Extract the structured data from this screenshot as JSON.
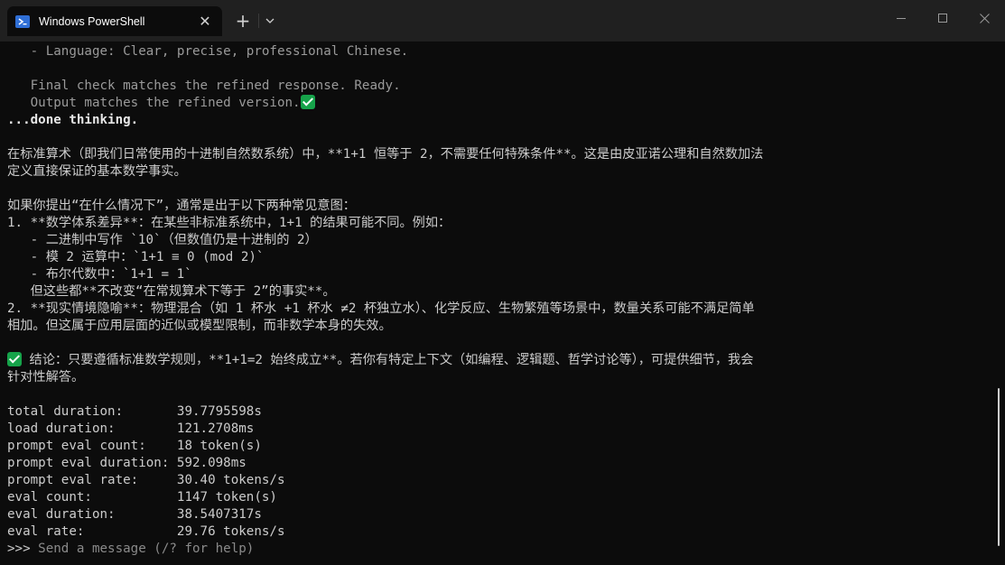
{
  "window": {
    "tab_title": "Windows PowerShell",
    "tab_close_glyph": "✕",
    "new_tab_glyph": "+",
    "dropdown_glyph": "⌄"
  },
  "terminal": {
    "lines": [
      {
        "text": "   - Language: Clear, precise, professional Chinese.",
        "style": "dim"
      },
      {
        "text": "",
        "style": ""
      },
      {
        "text": "   Final check matches the refined response. Ready.",
        "style": "dim"
      },
      {
        "text": "   Output matches the refined version.",
        "style": "dim",
        "check": true
      },
      {
        "text": "...done thinking.",
        "style": "bold"
      },
      {
        "text": "",
        "style": ""
      },
      {
        "text": "在标准算术（即我们日常使用的十进制自然数系统）中，**1+1 恒等于 2，不需要任何特殊条件**。这是由皮亚诺公理和自然数加法",
        "style": ""
      },
      {
        "text": "定义直接保证的基本数学事实。",
        "style": ""
      },
      {
        "text": "",
        "style": ""
      },
      {
        "text": "如果你提出“在什么情况下”，通常是出于以下两种常见意图：",
        "style": ""
      },
      {
        "text": "1. **数学体系差异**：在某些非标准系统中，1+1 的结果可能不同。例如：",
        "style": ""
      },
      {
        "text": "   - 二进制中写作 `10`（但数值仍是十进制的 2）",
        "style": ""
      },
      {
        "text": "   - 模 2 运算中：`1+1 ≡ 0 (mod 2)`",
        "style": ""
      },
      {
        "text": "   - 布尔代数中：`1+1 = 1`",
        "style": ""
      },
      {
        "text": "   但这些都**不改变“在常规算术下等于 2”的事实**。",
        "style": ""
      },
      {
        "text": "2. **现实情境隐喻**：物理混合（如 1 杯水 +1 杯水 ≠2 杯独立水）、化学反应、生物繁殖等场景中，数量关系可能不满足简单",
        "style": ""
      },
      {
        "text": "相加。但这属于应用层面的近似或模型限制，而非数学本身的失效。",
        "style": ""
      },
      {
        "text": "",
        "style": ""
      },
      {
        "text": " 结论：只要遵循标准数学规则，**1+1=2 始终成立**。若你有特定上下文（如编程、逻辑题、哲学讨论等），可提供细节，我会",
        "style": "",
        "check_prefix": true
      },
      {
        "text": "针对性解答。",
        "style": ""
      },
      {
        "text": "",
        "style": ""
      },
      {
        "text": "total duration:       39.7795598s",
        "style": ""
      },
      {
        "text": "load duration:        121.2708ms",
        "style": ""
      },
      {
        "text": "prompt eval count:    18 token(s)",
        "style": ""
      },
      {
        "text": "prompt eval duration: 592.098ms",
        "style": ""
      },
      {
        "text": "prompt eval rate:     30.40 tokens/s",
        "style": ""
      },
      {
        "text": "eval count:           1147 token(s)",
        "style": ""
      },
      {
        "text": "eval duration:        38.5407317s",
        "style": ""
      },
      {
        "text": "eval rate:            29.76 tokens/s",
        "style": ""
      }
    ],
    "prompt": ">>> ",
    "input_placeholder": "Send a message (/? for help)"
  }
}
